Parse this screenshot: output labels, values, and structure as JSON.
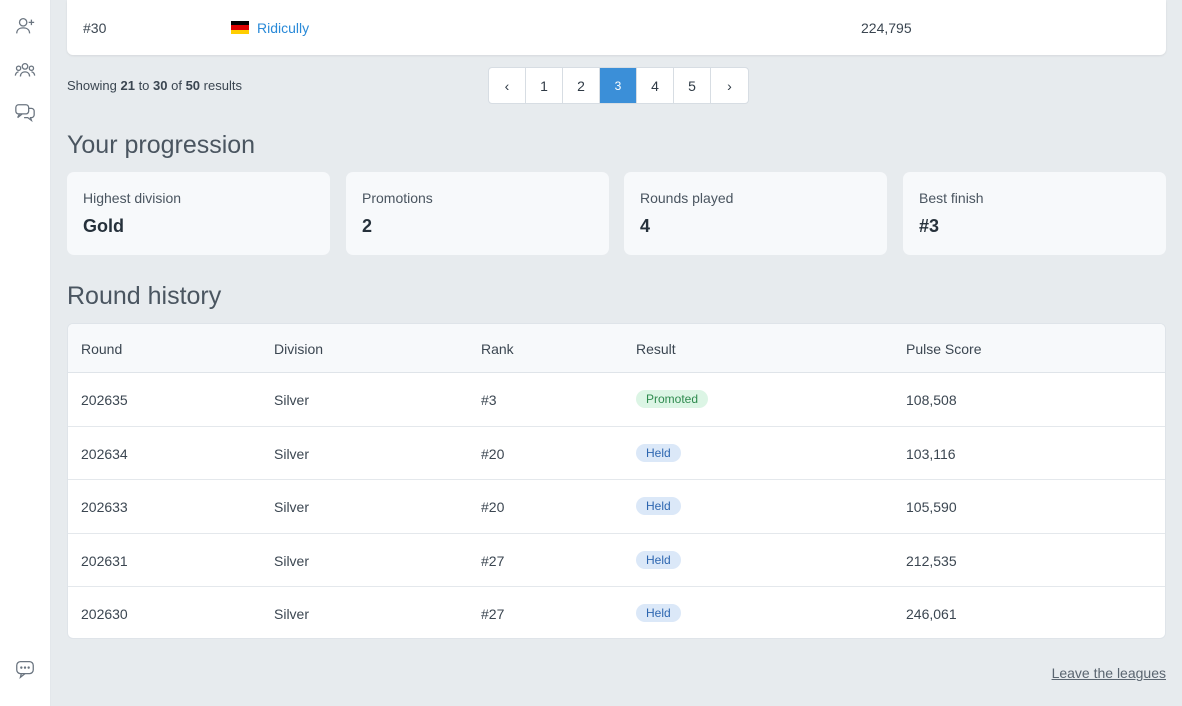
{
  "sidebar": {
    "icons": [
      "add-user-icon",
      "group-icon",
      "chat-bubbles-icon",
      "feedback-icon"
    ]
  },
  "leaderboard_last_row": {
    "rank": "#30",
    "flag": "germany-flag",
    "player": "Ridicully",
    "score": "224,795"
  },
  "pagination": {
    "showing_prefix": "Showing ",
    "from": "21",
    "to_word": " to ",
    "to": "30",
    "of_word": " of ",
    "total": "50",
    "suffix": " results",
    "prev": "‹",
    "next": "›",
    "pages": [
      "1",
      "2",
      "3",
      "4",
      "5"
    ],
    "current": "3"
  },
  "progression": {
    "title": "Your progression",
    "stats": [
      {
        "label": "Highest division",
        "value": "Gold"
      },
      {
        "label": "Promotions",
        "value": "2"
      },
      {
        "label": "Rounds played",
        "value": "4"
      },
      {
        "label": "Best finish",
        "value": "#3"
      }
    ]
  },
  "history": {
    "title": "Round history",
    "columns": [
      "Round",
      "Division",
      "Rank",
      "Result",
      "Pulse Score"
    ],
    "rows": [
      {
        "round": "202635",
        "division": "Silver",
        "rank": "#3",
        "result": "Promoted",
        "score": "108,508"
      },
      {
        "round": "202634",
        "division": "Silver",
        "rank": "#20",
        "result": "Held",
        "score": "103,116"
      },
      {
        "round": "202633",
        "division": "Silver",
        "rank": "#20",
        "result": "Held",
        "score": "105,590"
      },
      {
        "round": "202631",
        "division": "Silver",
        "rank": "#27",
        "result": "Held",
        "score": "212,535"
      },
      {
        "round": "202630",
        "division": "Silver",
        "rank": "#27",
        "result": "Held",
        "score": "246,061"
      }
    ]
  },
  "footer": {
    "leave_label": "Leave the leagues"
  },
  "colors": {
    "accent": "#3b8fd8",
    "link": "#2a8ad8",
    "promoted_bg": "#dcf5e5",
    "held_bg": "#dbe8f8"
  }
}
